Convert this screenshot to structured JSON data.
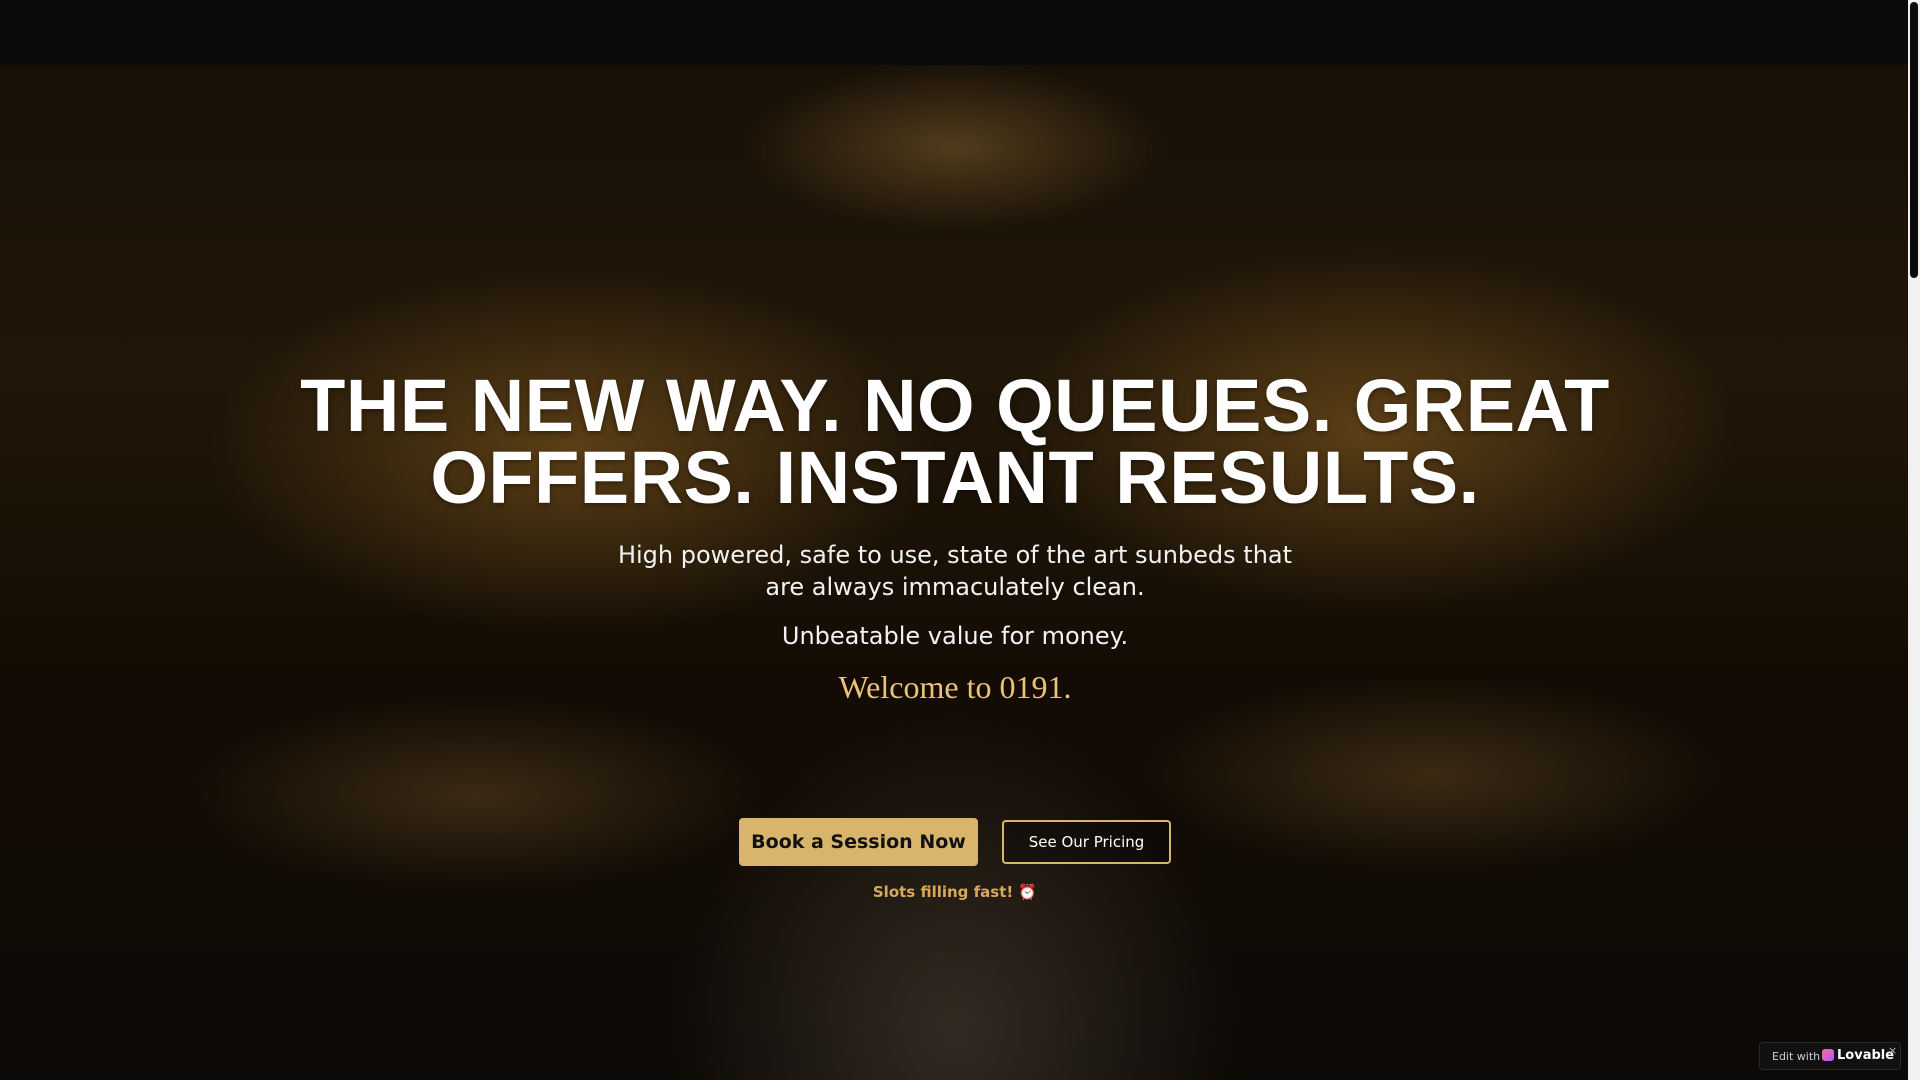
{
  "hero": {
    "headline": "THE NEW WAY. NO QUEUES. GREAT OFFERS. INSTANT RESULTS.",
    "subtitle": "High powered, safe to use, state of the art sunbeds that are always immaculately clean.",
    "value_line": "Unbeatable value for money.",
    "welcome": "Welcome to 0191.",
    "primary_cta": "Book a Session Now",
    "secondary_cta": "See Our Pricing",
    "urgency": "Slots filling fast! ⏰",
    "background_image": "luxury-tanning-salon-sunbeds"
  },
  "badge": {
    "edit_label": "Edit with",
    "brand": "Lovable",
    "close": "×"
  },
  "colors": {
    "accent_gold": "#d9b56c",
    "welcome_gold": "#e9c37a",
    "topbar": "#0b0b0b"
  }
}
